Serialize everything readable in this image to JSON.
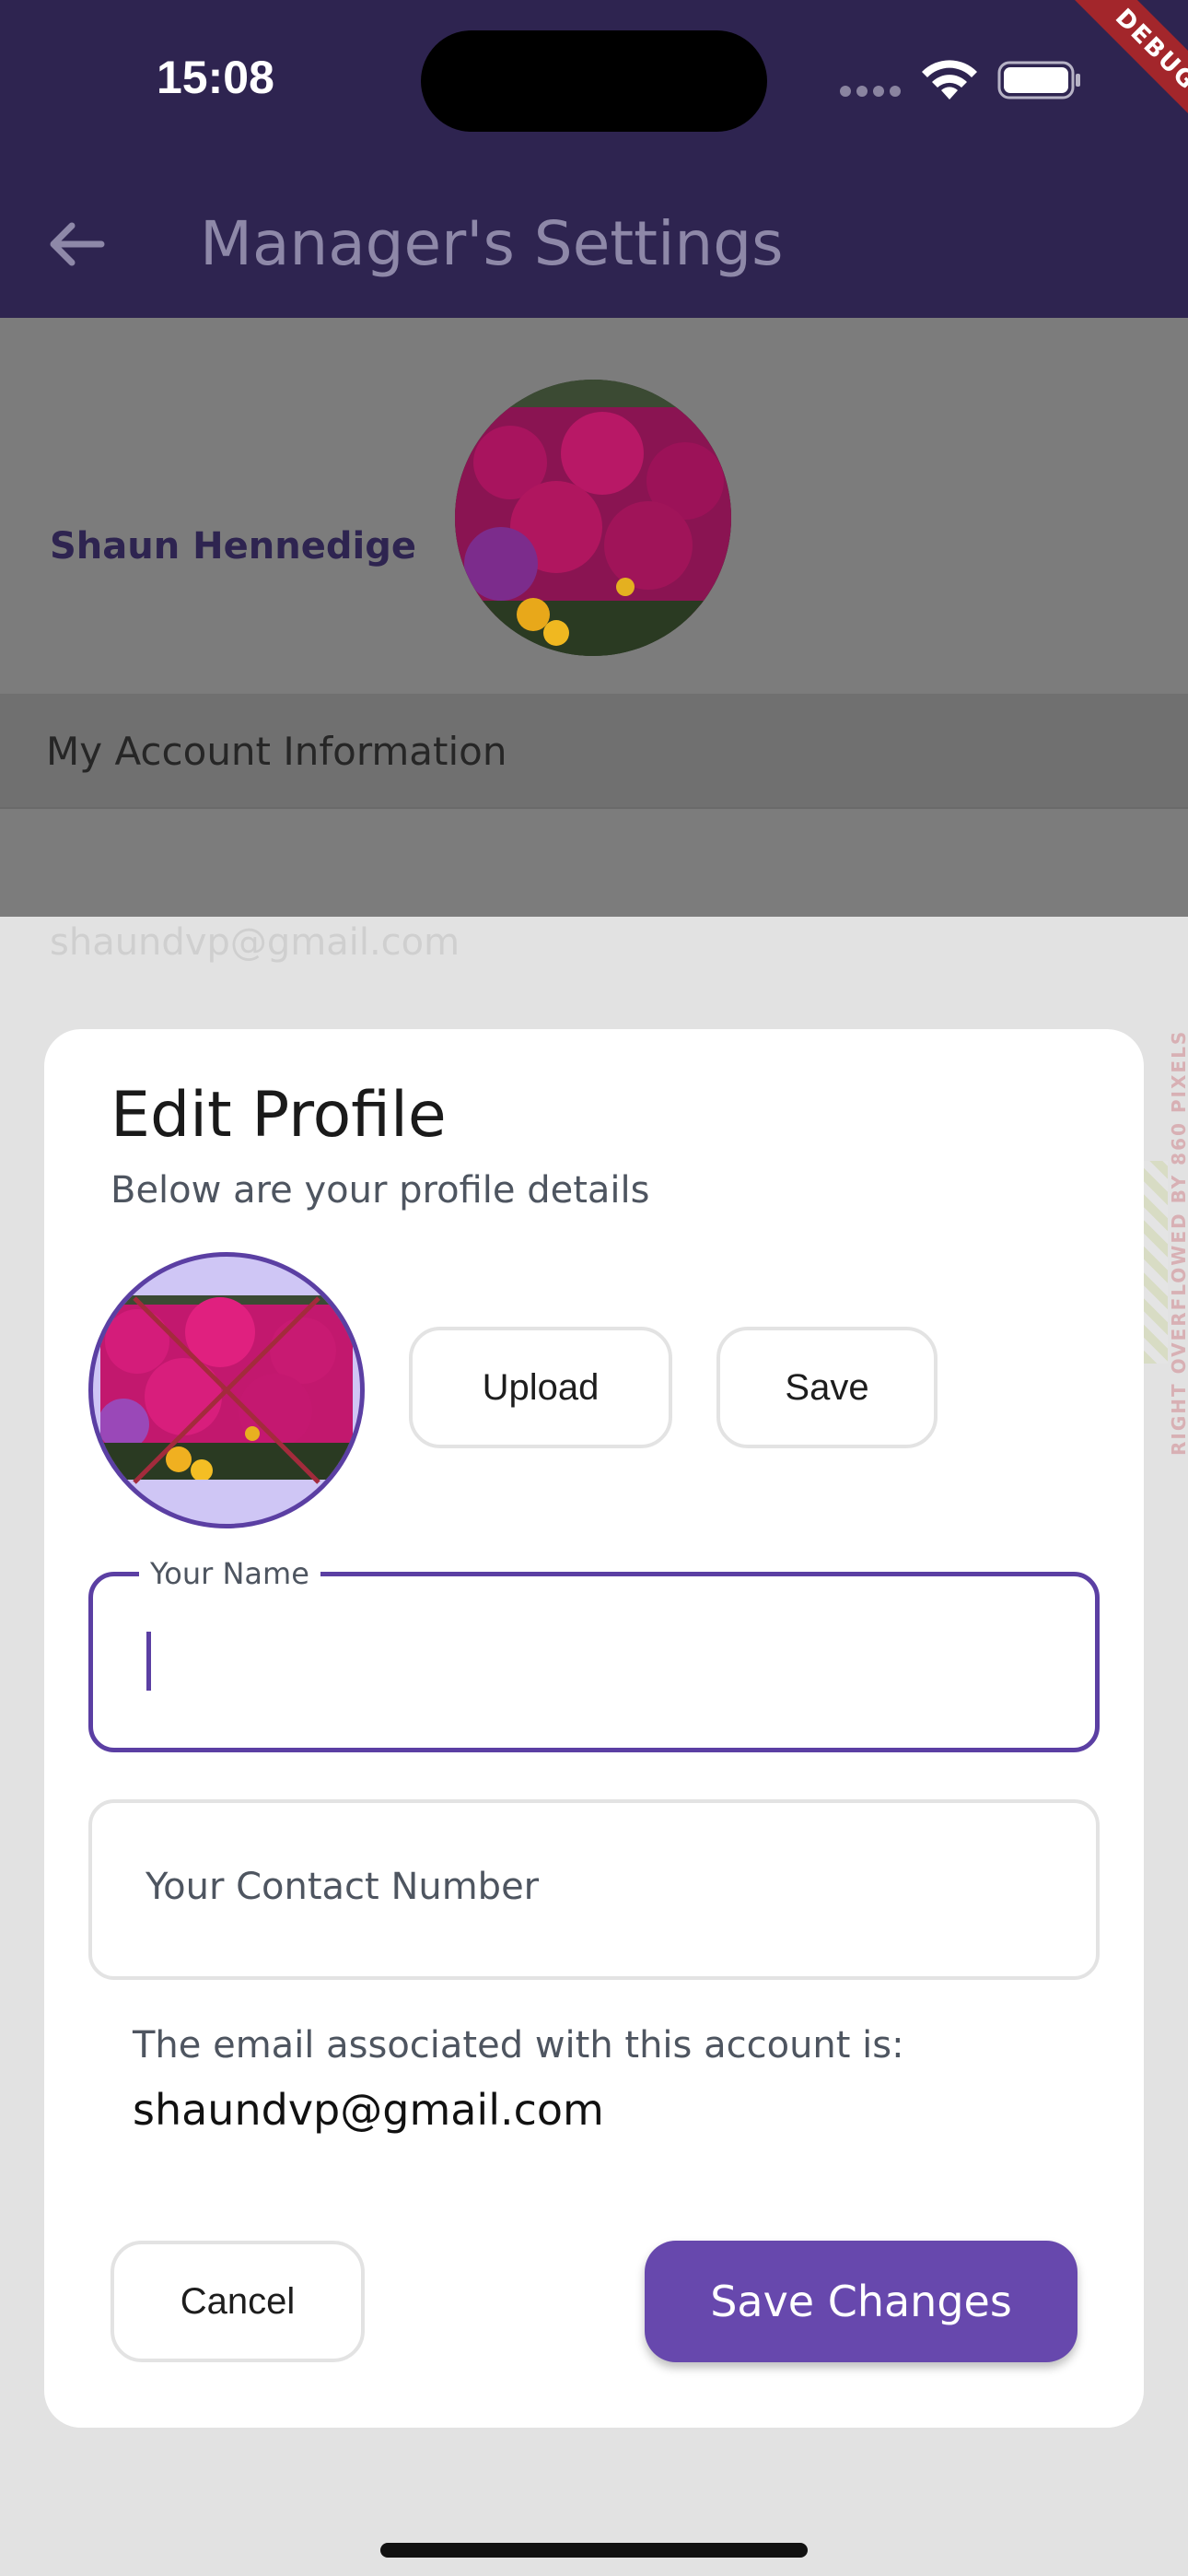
{
  "status_bar": {
    "time": "15:08",
    "debug_banner": "DEBUG"
  },
  "app_bar": {
    "title": "Manager's Settings",
    "back_icon": "arrow-left-icon"
  },
  "background": {
    "section_label": "My Account Information",
    "user_name": "Shaun Hennedige",
    "user_email": "shaundvp@gmail.com",
    "overflow_warning": "RIGHT OVERFLOWED BY 860 PIXELS"
  },
  "dialog": {
    "title": "Edit Profile",
    "subtitle": "Below are your profile details",
    "upload_label": "Upload",
    "save_label": "Save",
    "name_field": {
      "label": "Your Name",
      "value": ""
    },
    "contact_field": {
      "placeholder": "Your Contact Number",
      "value": ""
    },
    "email_info": "The email associated with this account is:",
    "email_value": "shaundvp@gmail.com",
    "cancel_label": "Cancel",
    "save_changes_label": "Save Changes"
  },
  "colors": {
    "app_bar": "#2e2450",
    "accent": "#6748ad",
    "debug": "#a3262b"
  }
}
